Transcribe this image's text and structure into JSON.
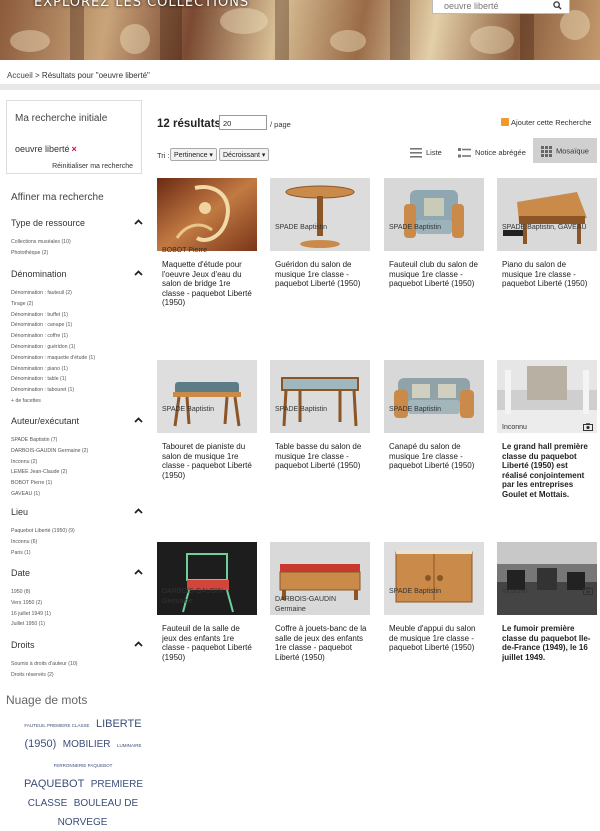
{
  "header": {
    "title": "EXPLOREZ LES COLLECTIONS",
    "search_value": "oeuvre liberté"
  },
  "breadcrumb": {
    "home": "Accueil",
    "separator": " > ",
    "current": "Résultats pour \"oeuvre liberté\""
  },
  "sidebar": {
    "initial_title": "Ma recherche initiale",
    "initial_term": "oeuvre liberté",
    "remove_glyph": "×",
    "reset_label": "Réinitialiser ma recherche",
    "refine_title": "Affiner ma recherche",
    "facets": [
      {
        "title": "Type de ressource",
        "items": [
          "Collections muséales (10)",
          "Photothèque (2)"
        ]
      },
      {
        "title": "Dénomination",
        "items": [
          "Dénomination : fauteuil (2)",
          "Tirage (2)",
          "Dénomination : buffet (1)",
          "Dénomination : canape (1)",
          "Dénomination : coffre (1)",
          "Dénomination : guéridon (1)",
          "Dénomination : maquette d'étude (1)",
          "Dénomination : piano (1)",
          "Dénomination : table (1)",
          "Dénomination : tabouret (1)"
        ],
        "more": "+ de facettes"
      },
      {
        "title": "Auteur/exécutant",
        "items": [
          "SPADE Baptistin (7)",
          "DARBOIS-GAUDIN Germaine (2)",
          "Inconnu (2)",
          "LEMEE Jean-Claude (2)",
          "BOBOT Pierre (1)",
          "GAVEAU (1)"
        ]
      },
      {
        "title": "Lieu",
        "items": [
          "Paquebot Liberté (1950) (9)",
          "Inconnu (6)",
          "Paris (1)"
        ]
      },
      {
        "title": "Date",
        "items": [
          "1950 (8)",
          "Vers 1950 (2)",
          "16 juillet 1949 (1)",
          "Juillet 1950 (1)"
        ]
      },
      {
        "title": "Droits",
        "items": [
          "Soumis à droits d'auteur (10)",
          "Droits réservés (2)"
        ]
      }
    ],
    "cloud_title": "Nuage de mots",
    "cloud_words": [
      {
        "text": "FAUTEUIL PREMIERE CLASSE",
        "size": "s"
      },
      {
        "text": "LIBERTE",
        "size": "l"
      },
      {
        "text": "(1950)",
        "size": "l"
      },
      {
        "text": "MOBILIER",
        "size": "m"
      },
      {
        "text": "LUMINAIRE",
        "size": "s"
      },
      {
        "text": "FERRONNERIE PAQUEBOT",
        "size": "s"
      },
      {
        "text": "PAQUEBOT",
        "size": "l"
      },
      {
        "text": "PREMIERE CLASSE",
        "size": "m"
      },
      {
        "text": "BOULEAU DE NORVEGE",
        "size": "m"
      }
    ]
  },
  "results": {
    "count": "12 résultats",
    "per_page": "20",
    "per_page_label": "/ page",
    "rss_label": "Ajouter cette Recherche",
    "sort_label": "Tri :",
    "sort_field": "Pertinence",
    "sort_order": "Décroissant",
    "views": [
      "Liste",
      "Notice abrégée",
      "Mosaïque"
    ]
  },
  "cards": [
    {
      "title": "Maquette d'étude pour l'oeuvre Jeux d'eau du salon de bridge 1re classe - paquebot Liberté (1950)",
      "author": "BOBOT Pierre",
      "photo": false
    },
    {
      "title": "Guéridon du salon de musique 1re classe - paquebot Liberté (1950)",
      "author": "SPADE Baptistin",
      "photo": false
    },
    {
      "title": "Fauteuil club du salon de musique 1re classe - paquebot Liberté (1950)",
      "author": "SPADE Baptistin",
      "photo": false
    },
    {
      "title": "Piano du salon de musique 1re classe - paquebot Liberté (1950)",
      "author": "SPADE Baptistin, GAVEAU",
      "photo": false
    },
    {
      "title": "Tabouret de pianiste du salon de musique 1re classe - paquebot Liberté (1950)",
      "author": "SPADE Baptistin",
      "photo": false
    },
    {
      "title": "Table basse du salon de musique 1re classe - paquebot Liberté (1950)",
      "author": "SPADE Baptistin",
      "photo": false
    },
    {
      "title": "Canapé du salon de musique 1re classe - paquebot Liberté (1950)",
      "author": "SPADE Baptistin",
      "photo": false
    },
    {
      "title": "Le grand hall première classe du paquebot Liberté (1950) est réalisé conjointement par les entreprises Goulet et Mottais.",
      "author": "Inconnu",
      "photo": true
    },
    {
      "title": "Fauteuil de la salle de jeux des enfants 1re classe - paquebot Liberté (1950)",
      "author": "DARBOIS-GAUDIN Germaine",
      "photo": false
    },
    {
      "title": "Coffre à jouets-banc de la salle de jeux des enfants 1re classe - paquebot Liberté (1950)",
      "author": "DARBOIS-GAUDIN Germaine",
      "photo": false
    },
    {
      "title": "Meuble d'appui du salon de musique 1re classe - paquebot Liberté (1950)",
      "author": "SPADE Baptistin",
      "photo": false
    },
    {
      "title": "Le fumoir première classe du paquebot Ile-de-France (1949), le 16 juillet 1949.",
      "author": "Inconnu",
      "photo": true
    }
  ]
}
